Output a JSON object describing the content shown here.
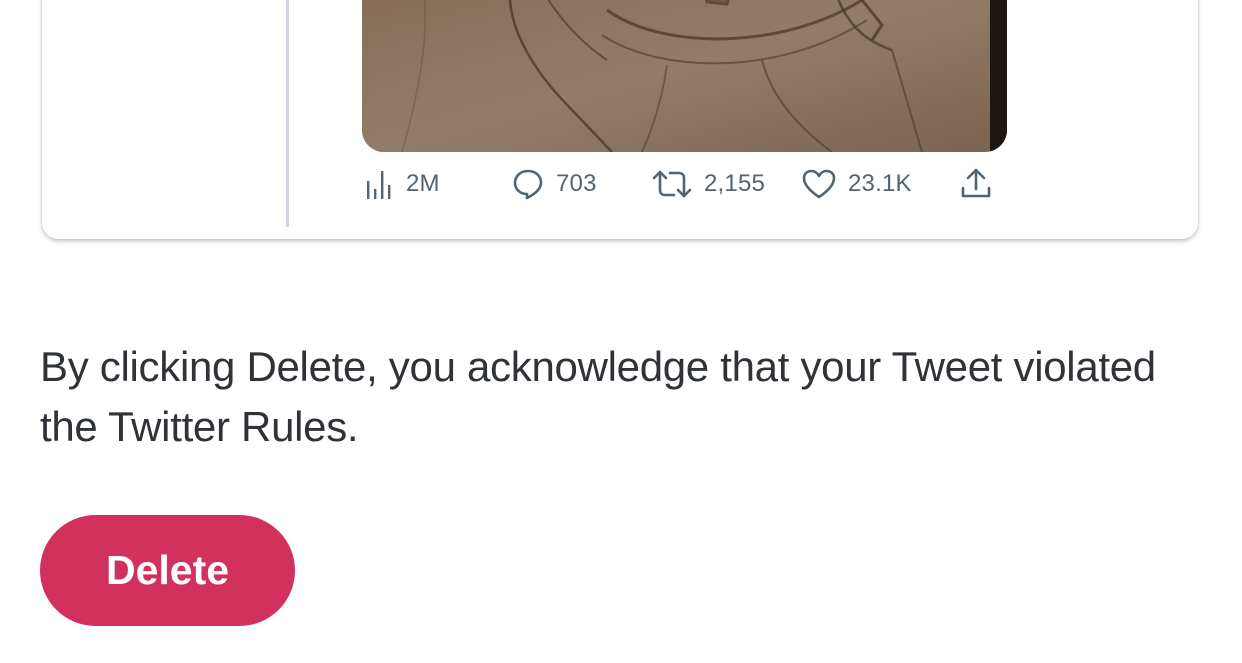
{
  "tweet": {
    "image_icon": "pencil-sketch-portrait",
    "actions": {
      "views": {
        "icon": "analytics-bars-icon",
        "count": "2M"
      },
      "replies": {
        "icon": "reply-bubble-icon",
        "count": "703"
      },
      "retweets": {
        "icon": "retweet-icon",
        "count": "2,155"
      },
      "likes": {
        "icon": "heart-icon",
        "count": "23.1K"
      },
      "share": {
        "icon": "share-upload-icon"
      }
    }
  },
  "notice": {
    "text": "By clicking Delete, you acknowledge that your Tweet violated the Twitter Rules."
  },
  "delete_button": {
    "label": "Delete"
  },
  "colors": {
    "delete_button_bg": "#d2305d",
    "icon_gray": "#536471",
    "thread_line": "#cfd3e3"
  }
}
